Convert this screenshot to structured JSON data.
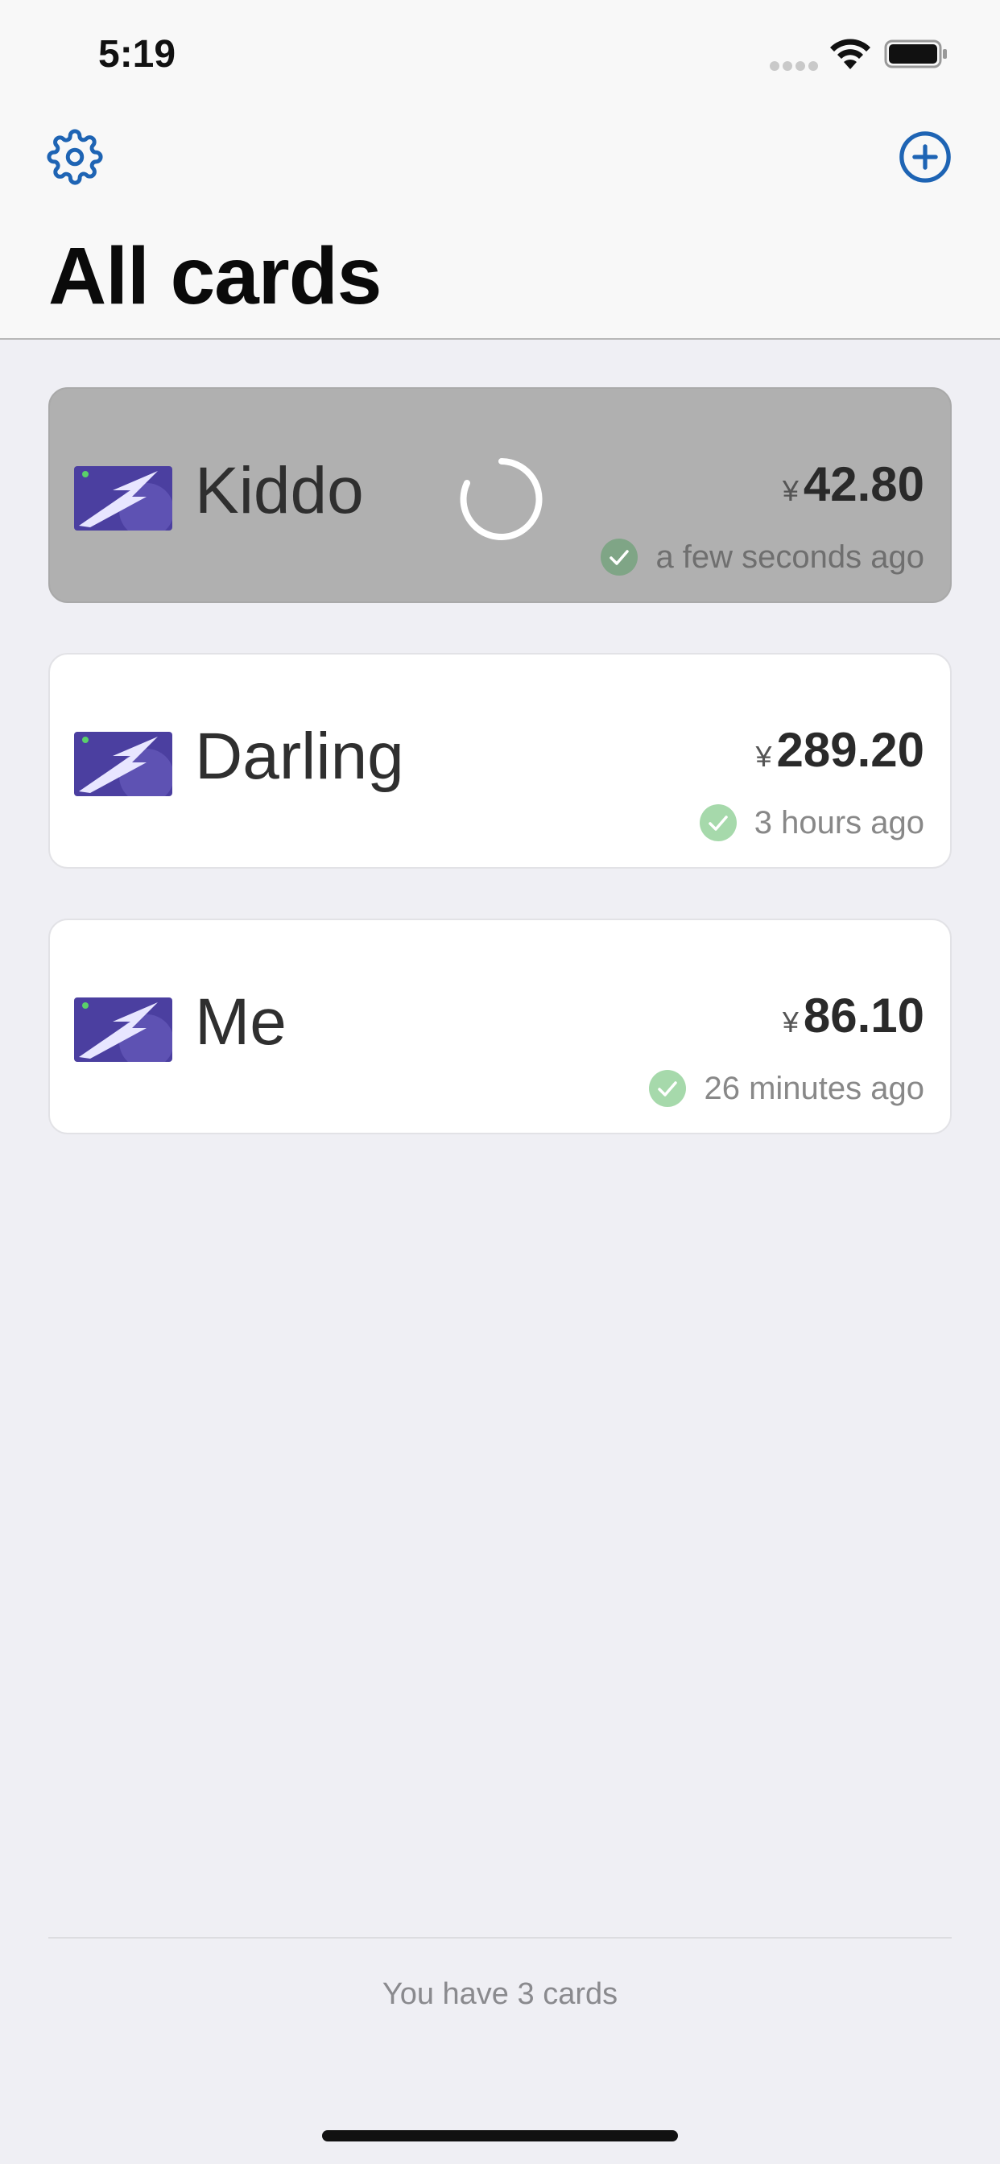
{
  "status_bar": {
    "time": "5:19"
  },
  "header": {
    "title": "All cards"
  },
  "colors": {
    "accent": "#1e64b4",
    "check": "#a6d9ab",
    "card_thumb": "#4b3fa0"
  },
  "icons": {
    "settings": "gear-icon",
    "add": "plus-circle-icon",
    "check": "check-circle-icon",
    "spinner": "spinner-icon"
  },
  "cards": [
    {
      "name": "Kiddo",
      "currency": "¥",
      "amount": "42.80",
      "updated": "a few seconds ago",
      "state": "refreshing"
    },
    {
      "name": "Darling",
      "currency": "¥",
      "amount": "289.20",
      "updated": "3 hours ago",
      "state": "idle"
    },
    {
      "name": "Me",
      "currency": "¥",
      "amount": "86.10",
      "updated": "26 minutes ago",
      "state": "idle"
    }
  ],
  "footer": {
    "text": "You have 3 cards"
  }
}
